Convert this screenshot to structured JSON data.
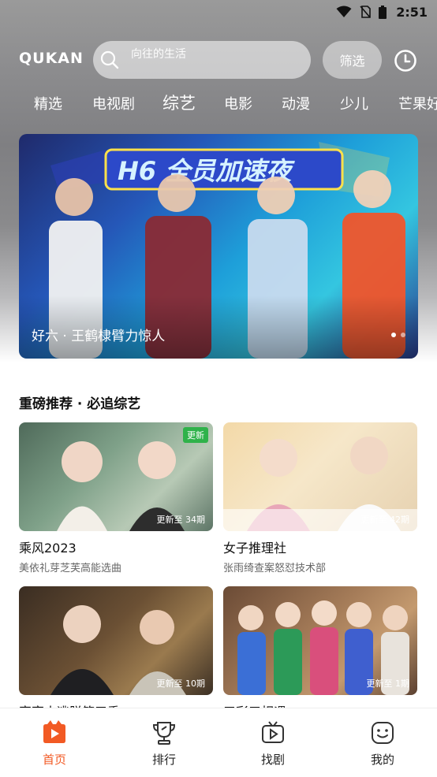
{
  "status_bar": {
    "time": "2:51"
  },
  "header": {
    "logo": "QUKAN",
    "search_placeholder": "向往的生活",
    "filter_label": "筛选",
    "history_icon": "clock-icon"
  },
  "tabs": [
    {
      "label": "精选",
      "active": false
    },
    {
      "label": "电视剧",
      "active": false
    },
    {
      "label": "综艺",
      "active": true
    },
    {
      "label": "电影",
      "active": false
    },
    {
      "label": "动漫",
      "active": false
    },
    {
      "label": "少儿",
      "active": false
    },
    {
      "label": "芒果好",
      "active": false
    }
  ],
  "banner": {
    "artwork_text": "H6 全员加速夜",
    "caption": "好六 · 王鹤棣臂力惊人"
  },
  "section": {
    "title": "重磅推荐 · 必追综艺"
  },
  "cards": [
    {
      "title": "乘风2023",
      "subtitle": "美依礼芽芝芙高能选曲",
      "episode": "更新至 34期",
      "badge": "更新"
    },
    {
      "title": "女子推理社",
      "subtitle": "张雨绮查案怒怼技术部",
      "episode": "更新至 42期"
    },
    {
      "title": "密室大逃脱第五季",
      "subtitle": "",
      "episode": "更新至 10期"
    },
    {
      "title": "五彩三相遇",
      "subtitle": "",
      "episode": "更新至 1期"
    }
  ],
  "bottom_nav": [
    {
      "label": "首页",
      "icon": "play-home-icon",
      "active": true
    },
    {
      "label": "排行",
      "icon": "trophy-icon",
      "active": false
    },
    {
      "label": "找剧",
      "icon": "tv-icon",
      "active": false
    },
    {
      "label": "我的",
      "icon": "smiley-face-icon",
      "active": false
    }
  ],
  "colors": {
    "accent": "#f25a24",
    "badge_green": "#2fb24a"
  }
}
